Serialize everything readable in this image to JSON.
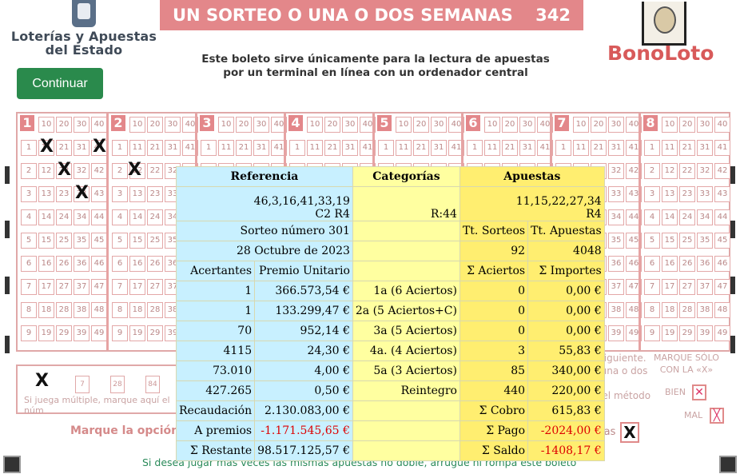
{
  "header": {
    "logo_line1": "Loterías y Apuestas",
    "logo_line2": "del Estado",
    "title": "UN SORTEO O UNA O DOS SEMANAS",
    "number": "342",
    "subtitle_line1": "Este boleto sirve únicamente para la lectura de apuestas",
    "subtitle_line2": "por un terminal en línea con un ordenador central",
    "brand": "BonoLoto"
  },
  "buttons": {
    "continue": "Continuar"
  },
  "grid": {
    "block_numbers": [
      "1",
      "2",
      "3",
      "4",
      "5",
      "6",
      "7",
      "8"
    ],
    "top_row": [
      "10",
      "20",
      "30",
      "40"
    ],
    "rows": [
      [
        "1",
        "11",
        "21",
        "31",
        "41"
      ],
      [
        "2",
        "12",
        "22",
        "32",
        "42"
      ],
      [
        "3",
        "13",
        "23",
        "33",
        "43"
      ],
      [
        "4",
        "14",
        "24",
        "34",
        "44"
      ],
      [
        "5",
        "15",
        "25",
        "35",
        "45"
      ],
      [
        "6",
        "16",
        "26",
        "36",
        "46"
      ],
      [
        "7",
        "17",
        "27",
        "37",
        "47"
      ],
      [
        "8",
        "18",
        "28",
        "38",
        "48"
      ],
      [
        "9",
        "19",
        "29",
        "39",
        "49"
      ]
    ]
  },
  "bottom": {
    "multiple_boxes": [
      "7",
      "28",
      "84"
    ],
    "multiple_text": "Si juega múltiple, marque aquí el núm",
    "marque_opcion": "Marque la opción q",
    "right_note1": "ediato siguiente.",
    "right_note2": "eos de una o dos",
    "right_note3": "gar por el método",
    "marque_solo_1": "MARQUE SÓLO",
    "marque_solo_2": "CON LA «X»",
    "bien": "BIEN",
    "mal": "MAL",
    "semanas": "semanas",
    "footer": "Si desea jugar más veces las mismas apuestas no doble, arrugue ni rompa este boleto"
  },
  "overlay": {
    "h_referencia": "Referencia",
    "h_categorias": "Categorías",
    "h_apuestas": "Apuestas",
    "ref_numbers": "46,3,16,41,33,19",
    "ref_code": "C2 R4",
    "cat_code": "R:44",
    "ap_numbers": "11,15,22,27,34",
    "ap_code": "R4",
    "sorteo": "Sorteo número 301",
    "tt_sorteos_label": "Tt. Sorteos",
    "tt_apuestas_label": "Tt. Apuestas",
    "fecha": "28 Octubre de 2023",
    "tt_sorteos": "92",
    "tt_apuestas": "4048",
    "h_acertantes": "Acertantes",
    "h_premio": "Premio Unitario",
    "h_aciertos": "Σ Aciertos",
    "h_importes": "Σ Importes",
    "rows": [
      {
        "acertantes": "1",
        "premio": "366.573,54 €",
        "categoria": "1a (6 Aciertos)",
        "aciertos": "0",
        "importe": "0,00 €"
      },
      {
        "acertantes": "1",
        "premio": "133.299,47 €",
        "categoria": "2a (5 Aciertos+C)",
        "aciertos": "0",
        "importe": "0,00 €"
      },
      {
        "acertantes": "70",
        "premio": "952,14 €",
        "categoria": "3a (5 Aciertos)",
        "aciertos": "0",
        "importe": "0,00 €"
      },
      {
        "acertantes": "4115",
        "premio": "24,30 €",
        "categoria": "4a. (4 Aciertos)",
        "aciertos": "3",
        "importe": "55,83 €"
      },
      {
        "acertantes": "73.010",
        "premio": "4,00 €",
        "categoria": "5a (3 Aciertos)",
        "aciertos": "85",
        "importe": "340,00 €"
      },
      {
        "acertantes": "427.265",
        "premio": "0,50 €",
        "categoria": "Reintegro",
        "aciertos": "440",
        "importe": "220,00 €"
      }
    ],
    "recaudacion_label": "Recaudación",
    "recaudacion": "2.130.083,00 €",
    "cobro_label": "Σ Cobro",
    "cobro": "615,83 €",
    "a_premios_label": "A premios",
    "a_premios": "-1.171.545,65 €",
    "pago_label": "Σ Pago",
    "pago": "-2024,00 €",
    "restante_label": "Σ Restante",
    "restante": "98.517.125,57 €",
    "saldo_label": "Σ Saldo",
    "saldo": "-1408,17 €"
  },
  "colors": {
    "ref_bg": "#c8f0ff",
    "cat_bg": "#ffffa0",
    "ap_bg": "#ffee70",
    "negative": "#d00",
    "button": "#2a8a4c",
    "title_band": "#e3878a"
  }
}
